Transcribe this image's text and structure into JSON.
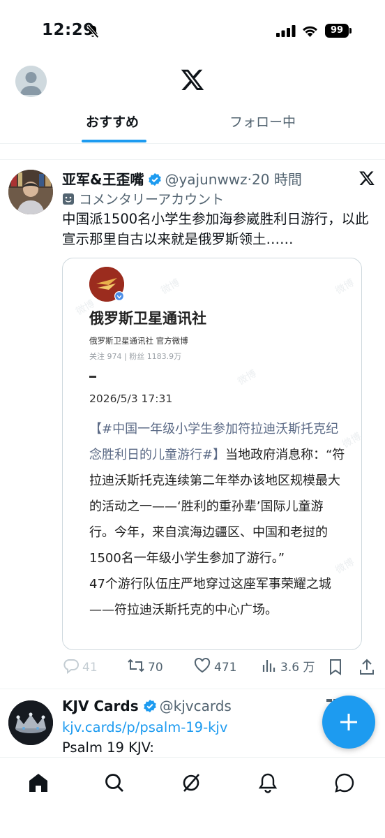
{
  "status_bar": {
    "time": "12:29",
    "battery": "99"
  },
  "tabs": {
    "recommended": "おすすめ",
    "following": "フォロー中"
  },
  "tweet1": {
    "display_name": "亚军&王歪嘴",
    "handle": "@yajunwwz",
    "time": "20 時間",
    "label": "コメンタリーアカウント",
    "text": "中国派1500名小学生参加海参崴胜利日游行，以此宣示那里自古以来就是俄罗斯领土……",
    "embed": {
      "account_name": "俄罗斯卫星通讯社",
      "account_sub": "俄罗斯卫星通讯社 官方微博",
      "stats": "关注 974 | 粉丝 1183.9万",
      "date": "2026/5/3 17:31",
      "hashtag": "【#中国一年级小学生参加符拉迪沃斯托克纪念胜利日的儿童游行#】",
      "body": "当地政府消息称：“符拉迪沃斯托克连续第二年举办该地区规模最大的活动之一——‘胜利的重孙辈’国际儿童游行。今年，来自滨海边疆区、中国和老挝的1500名一年级小学生参加了游行。”",
      "body2": "47个游行队伍庄严地穿过这座军事荣耀之城——符拉迪沃斯托克的中心广场。",
      "watermark": "微博"
    },
    "actions": {
      "replies": "41",
      "reposts": "70",
      "likes": "471",
      "views": "3.6 万"
    }
  },
  "tweet2": {
    "display_name": "KJV Cards",
    "handle": "@kjvcards",
    "link": "kjv.cards/p/psalm-19-kjv",
    "text": "Psalm 19 KJV:"
  },
  "colors": {
    "accent": "#1d9bf0",
    "text": "#0f1419",
    "secondary": "#536471"
  }
}
